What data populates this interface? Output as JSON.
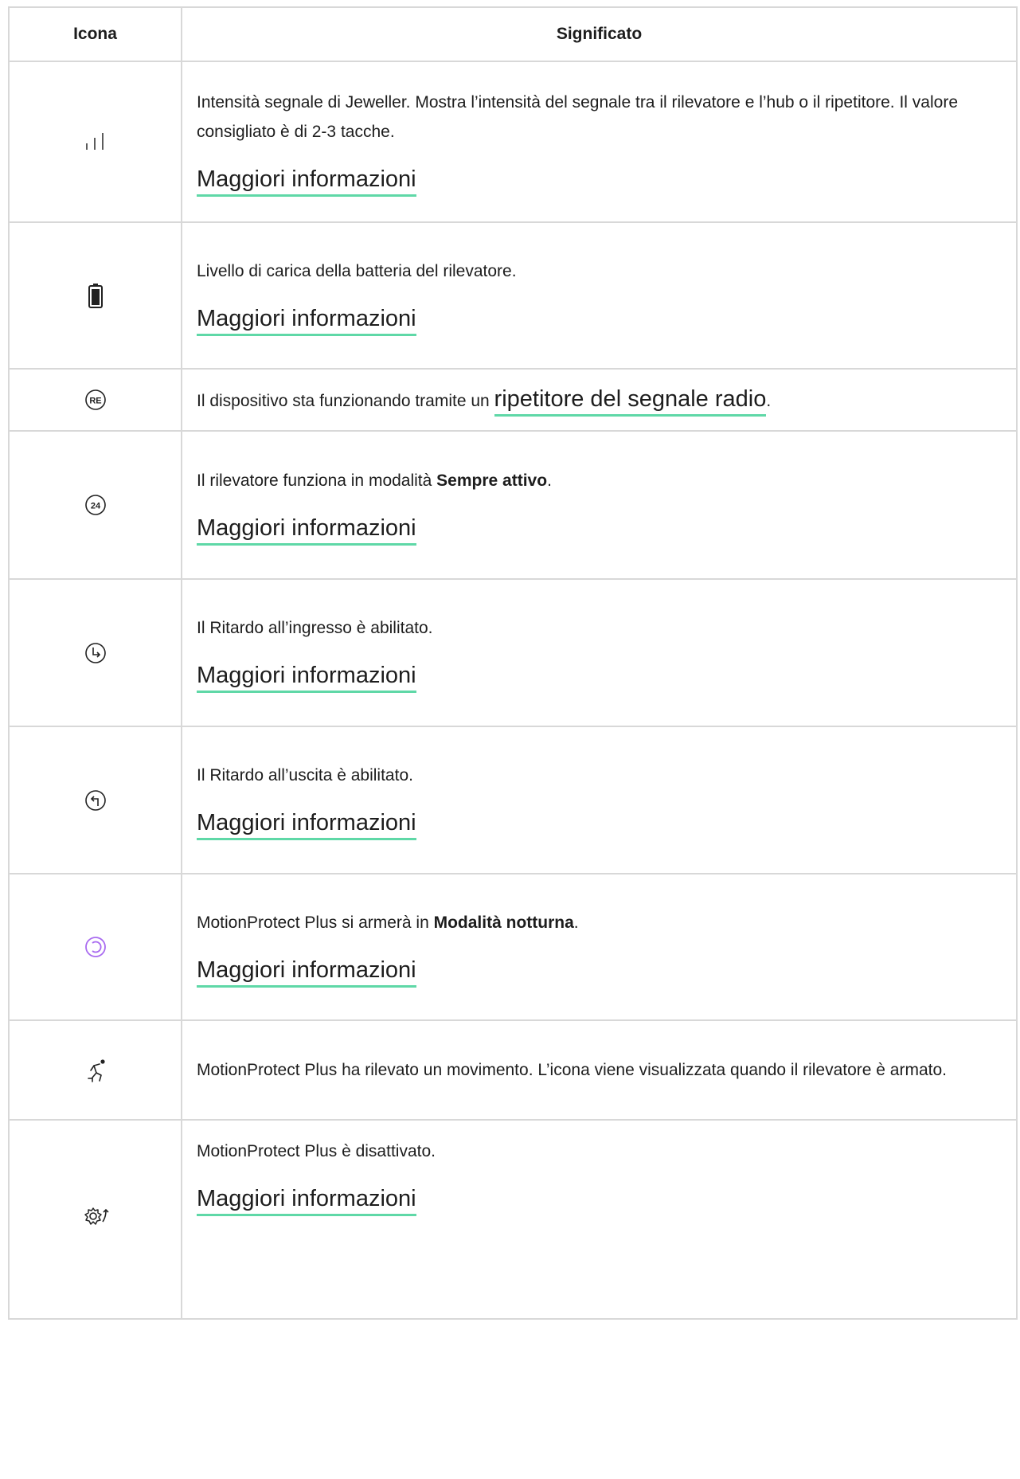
{
  "headers": {
    "icon": "Icona",
    "meaning": "Significato"
  },
  "colors": {
    "link_underline": "#5fd8a7",
    "night_icon": "#a96bf0",
    "border": "#d8d8d8"
  },
  "rows": [
    {
      "icon": "signal-strength-icon",
      "text": "Intensità segnale di Jeweller. Mostra l’intensità del segnale tra il rilevatore e l’hub o il ripetitore. Il valore consigliato è di 2-3 tacche.",
      "link": "Maggiori informazioni"
    },
    {
      "icon": "battery-icon",
      "text": "Livello di carica della batteria del rilevatore.",
      "link": "Maggiori informazioni"
    },
    {
      "icon": "repeater-re-icon",
      "text_before": "Il dispositivo sta funzionando tramite un ",
      "inline_link": "ripetitore del segnale radio",
      "text_after": "."
    },
    {
      "icon": "always-active-24-icon",
      "text_before": "Il rilevatore funziona in modalità ",
      "bold": "Sempre attivo",
      "text_after": ".",
      "link": "Maggiori informazioni"
    },
    {
      "icon": "entry-delay-icon",
      "text": "Il Ritardo all’ingresso è abilitato.",
      "link": "Maggiori informazioni"
    },
    {
      "icon": "exit-delay-icon",
      "text": "Il Ritardo all’uscita è abilitato.",
      "link": "Maggiori informazioni"
    },
    {
      "icon": "night-mode-icon",
      "text_before": "MotionProtect Plus si armerà in ",
      "bold": "Modalità notturna",
      "text_after": ".",
      "link": "Maggiori informazioni"
    },
    {
      "icon": "motion-detected-icon",
      "text": "MotionProtect Plus ha rilevato un movimento. L’icona viene visualizzata quando il rilevatore è armato."
    },
    {
      "icon": "deactivated-gear-icon",
      "text": "MotionProtect Plus è disattivato.",
      "link": "Maggiori informazioni"
    }
  ]
}
